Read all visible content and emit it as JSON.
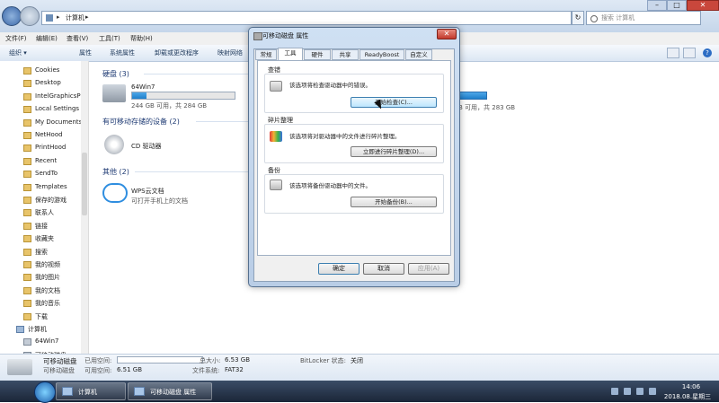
{
  "address": {
    "location": "计算机",
    "search_placeholder": "搜索 计算机"
  },
  "menu": [
    "文件(F)",
    "编辑(E)",
    "查看(V)",
    "工具(T)",
    "帮助(H)"
  ],
  "toolbar": [
    "组织 ▾",
    "属性",
    "系统属性",
    "卸载或更改程序",
    "映射网络"
  ],
  "sidebar": [
    "Cookies",
    "Desktop",
    "IntelGraphicsP",
    "Local Settings",
    "My Documents",
    "NetHood",
    "PrintHood",
    "Recent",
    "SendTo",
    "Templates",
    "保存的游戏",
    "联系人",
    "链接",
    "收藏夹",
    "搜索",
    "我的视频",
    "我的图片",
    "我的文档",
    "我的音乐",
    "下载",
    "计算机",
    "64Win7",
    "可移动磁盘"
  ],
  "content": {
    "hard_disks_header": "硬盘 (3)",
    "drive_name": "64Win7",
    "drive_space": "244 GB 可用，共 284 GB",
    "drive_used_fraction": 0.14,
    "right_drive_space": "B 可用，共 283 GB",
    "removable_header": "有可移动存储的设备 (2)",
    "cd_label": "CD 驱动器",
    "other_header": "其他 (2)",
    "wps_label": "WPS云文档",
    "wps_sub": "可打开手机上的文档"
  },
  "details": {
    "name": "可移动磁盘",
    "type": "可移动磁盘",
    "used_label": "已用空间:",
    "free_label": "可用空间:",
    "free_value": "6.51 GB",
    "total_label": "总大小:",
    "total_value": "6.53 GB",
    "fs_label": "文件系统:",
    "fs_value": "FAT32",
    "bitlocker_label": "BitLocker 状态:",
    "bitlocker_value": "关闭"
  },
  "taskbar": {
    "task1": "计算机",
    "task2": "可移动磁盘 属性",
    "time": "14:06",
    "date": "2018.08.星期三"
  },
  "dialog": {
    "title": "可移动磁盘 属性",
    "tabs": [
      "常规",
      "工具",
      "硬件",
      "共享",
      "ReadyBoost",
      "自定义"
    ],
    "active_tab": "工具",
    "check_section": "查错",
    "check_text": "该选项将检查驱动器中的错误。",
    "check_button": "开始检查(C)...",
    "defrag_section": "碎片整理",
    "defrag_text": "该选项将对驱动器中的文件进行碎片整理。",
    "defrag_button": "立即进行碎片整理(D)...",
    "backup_section": "备份",
    "backup_text": "该选项将备份驱动器中的文件。",
    "backup_button": "开始备份(B)...",
    "ok": "确定",
    "cancel": "取消",
    "apply": "应用(A)"
  }
}
